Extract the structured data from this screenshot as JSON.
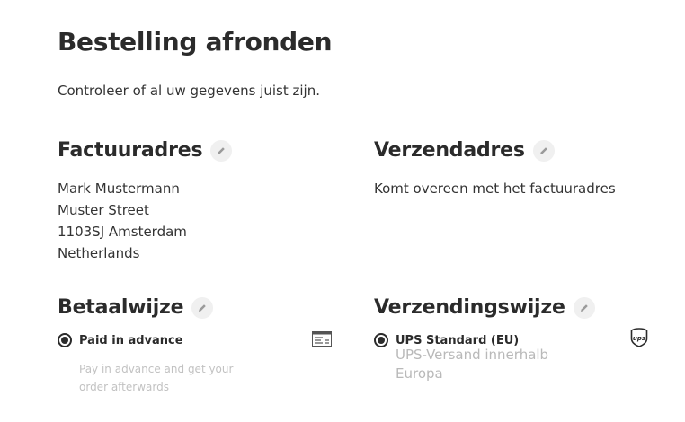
{
  "page": {
    "title": "Bestelling afronden",
    "intro": "Controleer of al uw gegevens juist zijn."
  },
  "billing": {
    "title": "Factuuradres",
    "edit_icon": "pencil-icon",
    "lines": [
      "Mark Mustermann",
      "Muster Street",
      "1103SJ Amsterdam",
      "Netherlands"
    ]
  },
  "shipping_address": {
    "title": "Verzendadres",
    "edit_icon": "pencil-icon",
    "text": "Komt overeen met het factuuradres"
  },
  "payment": {
    "title": "Betaalwijze",
    "edit_icon": "pencil-icon",
    "option": {
      "label": "Paid in advance",
      "description": "Pay in advance and get your order afterwards",
      "selected": true,
      "icon": "invoice-icon"
    }
  },
  "shipping_method": {
    "title": "Verzendingswijze",
    "edit_icon": "pencil-icon",
    "option": {
      "label": "UPS Standard (EU)",
      "description": "UPS-Versand innerhalb Europa",
      "selected": true,
      "icon": "ups-logo-icon"
    }
  },
  "colors": {
    "text": "#2b2b2b",
    "muted": "#c2c2c2",
    "edit_bg": "#f0f0f0"
  }
}
